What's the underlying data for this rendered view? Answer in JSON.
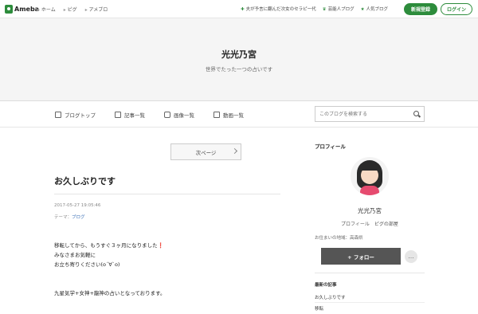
{
  "topbar": {
    "logo": "Ameba",
    "crumbs": [
      "ホーム",
      "ピグ",
      "アメブロ"
    ],
    "links": [
      "夫が予言に翻んだ次女のセラピー代",
      "芸能人ブログ",
      "人気ブログ"
    ],
    "register": "新規登録",
    "login": "ログイン"
  },
  "header": {
    "title": "光光乃宮",
    "subtitle": "世界でたった一つの占いです"
  },
  "nav": {
    "items": [
      "ブログトップ",
      "記事一覧",
      "画像一覧",
      "動画一覧"
    ],
    "search_placeholder": "このブログを検索する"
  },
  "pager": {
    "next": "次ページ"
  },
  "post": {
    "title": "お久しぶりです",
    "date": "2017-05-27 19:05:46",
    "theme_label": "テーマ：",
    "theme": "ブログ",
    "lines": [
      "移転してから、もうすぐ３ヶ月になりました",
      "みなさまお気軽に",
      "お立ち寄りください(o´∀`o)",
      "九星気学+女神+龍神の占いとなっております。"
    ],
    "exclaim": "❗"
  },
  "sidebar": {
    "profile_head": "プロフィール",
    "name": "光光乃宮",
    "links": "プロフィール　ピグの部屋",
    "location": "お住まいの地域：高森県",
    "follow": "+ フォロー",
    "more": "…",
    "recent_head": "最新の記事",
    "recent": [
      "お久しぶりです",
      "移転"
    ]
  },
  "colors": {
    "accent": "#2d8c3c",
    "follow_bg": "#555555"
  }
}
